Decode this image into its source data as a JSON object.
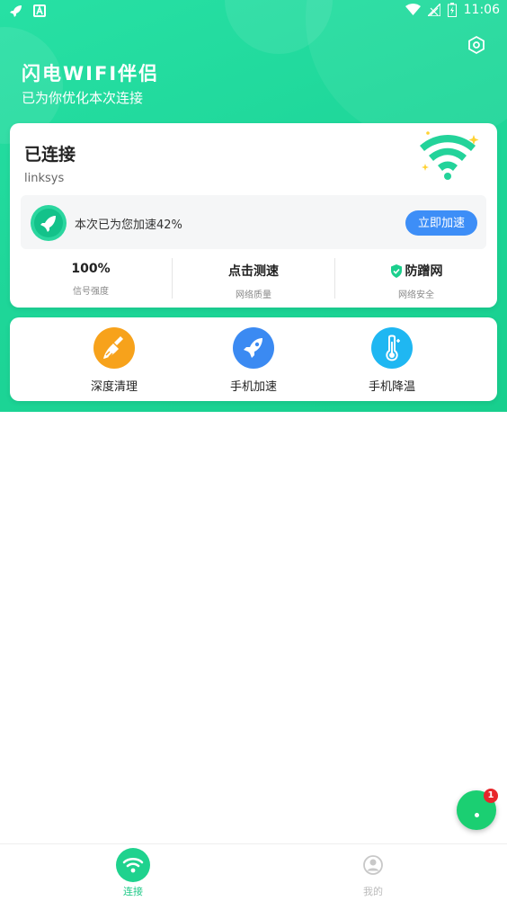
{
  "status_bar": {
    "time": "11:06",
    "left_icons": [
      "rocket-notification-icon",
      "app-notification-icon"
    ],
    "right_icons": [
      "wifi-signal-icon",
      "cellular-signal-icon",
      "battery-icon"
    ]
  },
  "header": {
    "title": "闪电WIFI伴侣",
    "subtitle": "已为你优化本次连接",
    "settings_icon": "hexagon-settings-icon"
  },
  "connection_card": {
    "status": "已连接",
    "ssid": "linksys",
    "boost_text": "本次已为您加速42%",
    "boost_button": "立即加速",
    "stats": [
      {
        "value": "100%",
        "label": "信号强度",
        "icon": ""
      },
      {
        "value": "点击测速",
        "label": "网络质量",
        "icon": ""
      },
      {
        "value": "防蹭网",
        "label": "网络安全",
        "icon": "shield-icon"
      }
    ]
  },
  "tools": [
    {
      "label": "深度清理",
      "icon": "broom-icon",
      "color": "#f7a21b"
    },
    {
      "label": "手机加速",
      "icon": "rocket-icon",
      "color": "#3b8af2"
    },
    {
      "label": "手机降温",
      "icon": "thermometer-icon",
      "color": "#1fb7f2"
    }
  ],
  "fab": {
    "badge": "1"
  },
  "tab_bar": {
    "items": [
      {
        "label": "连接",
        "icon": "wifi-icon",
        "active": true
      },
      {
        "label": "我的",
        "icon": "user-icon",
        "active": false
      }
    ]
  },
  "colors": {
    "accent": "#1fd79a",
    "button_blue": "#3d8ef7",
    "tab_inactive": "#bbbbbb"
  }
}
